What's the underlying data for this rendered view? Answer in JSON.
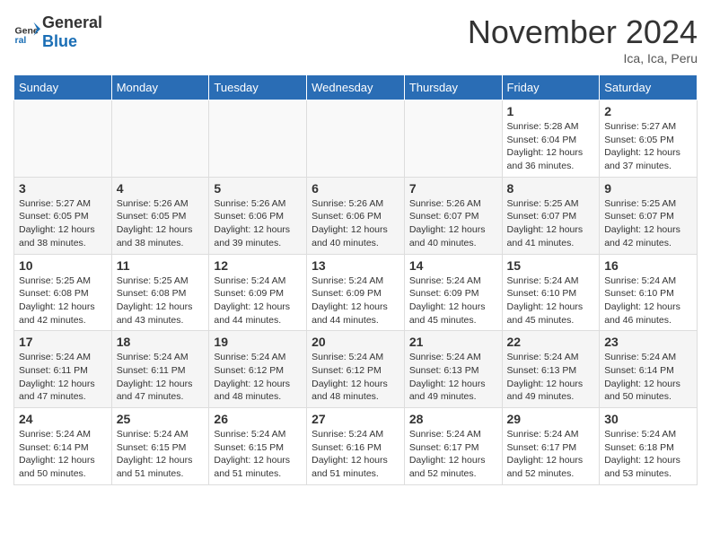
{
  "header": {
    "logo_general": "General",
    "logo_blue": "Blue",
    "month_title": "November 2024",
    "location": "Ica, Ica, Peru"
  },
  "weekdays": [
    "Sunday",
    "Monday",
    "Tuesday",
    "Wednesday",
    "Thursday",
    "Friday",
    "Saturday"
  ],
  "weeks": [
    [
      {
        "day": "",
        "info": ""
      },
      {
        "day": "",
        "info": ""
      },
      {
        "day": "",
        "info": ""
      },
      {
        "day": "",
        "info": ""
      },
      {
        "day": "",
        "info": ""
      },
      {
        "day": "1",
        "info": "Sunrise: 5:28 AM\nSunset: 6:04 PM\nDaylight: 12 hours and 36 minutes."
      },
      {
        "day": "2",
        "info": "Sunrise: 5:27 AM\nSunset: 6:05 PM\nDaylight: 12 hours and 37 minutes."
      }
    ],
    [
      {
        "day": "3",
        "info": "Sunrise: 5:27 AM\nSunset: 6:05 PM\nDaylight: 12 hours and 38 minutes."
      },
      {
        "day": "4",
        "info": "Sunrise: 5:26 AM\nSunset: 6:05 PM\nDaylight: 12 hours and 38 minutes."
      },
      {
        "day": "5",
        "info": "Sunrise: 5:26 AM\nSunset: 6:06 PM\nDaylight: 12 hours and 39 minutes."
      },
      {
        "day": "6",
        "info": "Sunrise: 5:26 AM\nSunset: 6:06 PM\nDaylight: 12 hours and 40 minutes."
      },
      {
        "day": "7",
        "info": "Sunrise: 5:26 AM\nSunset: 6:07 PM\nDaylight: 12 hours and 40 minutes."
      },
      {
        "day": "8",
        "info": "Sunrise: 5:25 AM\nSunset: 6:07 PM\nDaylight: 12 hours and 41 minutes."
      },
      {
        "day": "9",
        "info": "Sunrise: 5:25 AM\nSunset: 6:07 PM\nDaylight: 12 hours and 42 minutes."
      }
    ],
    [
      {
        "day": "10",
        "info": "Sunrise: 5:25 AM\nSunset: 6:08 PM\nDaylight: 12 hours and 42 minutes."
      },
      {
        "day": "11",
        "info": "Sunrise: 5:25 AM\nSunset: 6:08 PM\nDaylight: 12 hours and 43 minutes."
      },
      {
        "day": "12",
        "info": "Sunrise: 5:24 AM\nSunset: 6:09 PM\nDaylight: 12 hours and 44 minutes."
      },
      {
        "day": "13",
        "info": "Sunrise: 5:24 AM\nSunset: 6:09 PM\nDaylight: 12 hours and 44 minutes."
      },
      {
        "day": "14",
        "info": "Sunrise: 5:24 AM\nSunset: 6:09 PM\nDaylight: 12 hours and 45 minutes."
      },
      {
        "day": "15",
        "info": "Sunrise: 5:24 AM\nSunset: 6:10 PM\nDaylight: 12 hours and 45 minutes."
      },
      {
        "day": "16",
        "info": "Sunrise: 5:24 AM\nSunset: 6:10 PM\nDaylight: 12 hours and 46 minutes."
      }
    ],
    [
      {
        "day": "17",
        "info": "Sunrise: 5:24 AM\nSunset: 6:11 PM\nDaylight: 12 hours and 47 minutes."
      },
      {
        "day": "18",
        "info": "Sunrise: 5:24 AM\nSunset: 6:11 PM\nDaylight: 12 hours and 47 minutes."
      },
      {
        "day": "19",
        "info": "Sunrise: 5:24 AM\nSunset: 6:12 PM\nDaylight: 12 hours and 48 minutes."
      },
      {
        "day": "20",
        "info": "Sunrise: 5:24 AM\nSunset: 6:12 PM\nDaylight: 12 hours and 48 minutes."
      },
      {
        "day": "21",
        "info": "Sunrise: 5:24 AM\nSunset: 6:13 PM\nDaylight: 12 hours and 49 minutes."
      },
      {
        "day": "22",
        "info": "Sunrise: 5:24 AM\nSunset: 6:13 PM\nDaylight: 12 hours and 49 minutes."
      },
      {
        "day": "23",
        "info": "Sunrise: 5:24 AM\nSunset: 6:14 PM\nDaylight: 12 hours and 50 minutes."
      }
    ],
    [
      {
        "day": "24",
        "info": "Sunrise: 5:24 AM\nSunset: 6:14 PM\nDaylight: 12 hours and 50 minutes."
      },
      {
        "day": "25",
        "info": "Sunrise: 5:24 AM\nSunset: 6:15 PM\nDaylight: 12 hours and 51 minutes."
      },
      {
        "day": "26",
        "info": "Sunrise: 5:24 AM\nSunset: 6:15 PM\nDaylight: 12 hours and 51 minutes."
      },
      {
        "day": "27",
        "info": "Sunrise: 5:24 AM\nSunset: 6:16 PM\nDaylight: 12 hours and 51 minutes."
      },
      {
        "day": "28",
        "info": "Sunrise: 5:24 AM\nSunset: 6:17 PM\nDaylight: 12 hours and 52 minutes."
      },
      {
        "day": "29",
        "info": "Sunrise: 5:24 AM\nSunset: 6:17 PM\nDaylight: 12 hours and 52 minutes."
      },
      {
        "day": "30",
        "info": "Sunrise: 5:24 AM\nSunset: 6:18 PM\nDaylight: 12 hours and 53 minutes."
      }
    ]
  ]
}
